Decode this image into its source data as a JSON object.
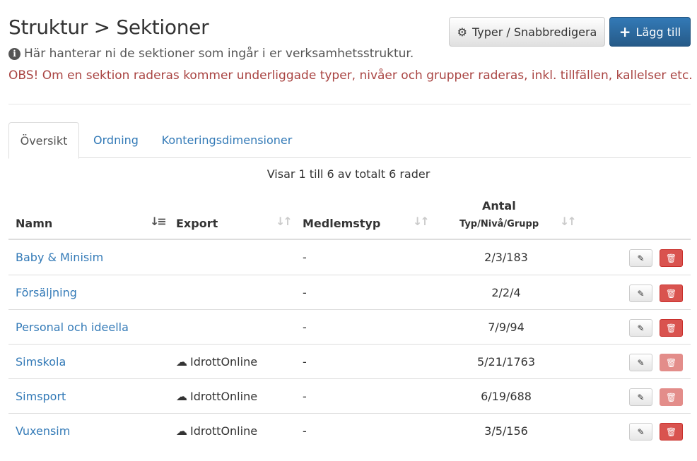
{
  "header": {
    "title": "Struktur > Sektioner",
    "subtitle": "Här hanterar ni de sektioner som ingår i er verksamhetsstruktur.",
    "warning": "OBS! Om en sektion raderas kommer underliggade typer, nivåer och grupper raderas, inkl. tillfällen, kallelser etc.",
    "types_button": "Typer / Snabbredigera",
    "add_button": "Lägg till"
  },
  "tabs": [
    {
      "label": "Översikt",
      "active": true
    },
    {
      "label": "Ordning",
      "active": false
    },
    {
      "label": "Konteringsdimensioner",
      "active": false
    }
  ],
  "summary": "Visar 1 till 6 av totalt 6 rader",
  "table": {
    "columns": {
      "name": "Namn",
      "export": "Export",
      "member_type": "Medlemstyp",
      "count": "Antal",
      "count_sub": "Typ/Nivå/Grupp"
    },
    "rows": [
      {
        "name": "Baby & Minisim",
        "export": "",
        "member_type": "-",
        "count": "2/3/183",
        "delete_enabled": true
      },
      {
        "name": "Försäljning",
        "export": "",
        "member_type": "-",
        "count": "2/2/4",
        "delete_enabled": true
      },
      {
        "name": "Personal och ideella",
        "export": "",
        "member_type": "-",
        "count": "7/9/94",
        "delete_enabled": true
      },
      {
        "name": "Simskola",
        "export": "IdrottOnline",
        "member_type": "-",
        "count": "5/21/1763",
        "delete_enabled": false
      },
      {
        "name": "Simsport",
        "export": "IdrottOnline",
        "member_type": "-",
        "count": "6/19/688",
        "delete_enabled": false
      },
      {
        "name": "Vuxensim",
        "export": "IdrottOnline",
        "member_type": "-",
        "count": "3/5/156",
        "delete_enabled": true
      }
    ]
  }
}
